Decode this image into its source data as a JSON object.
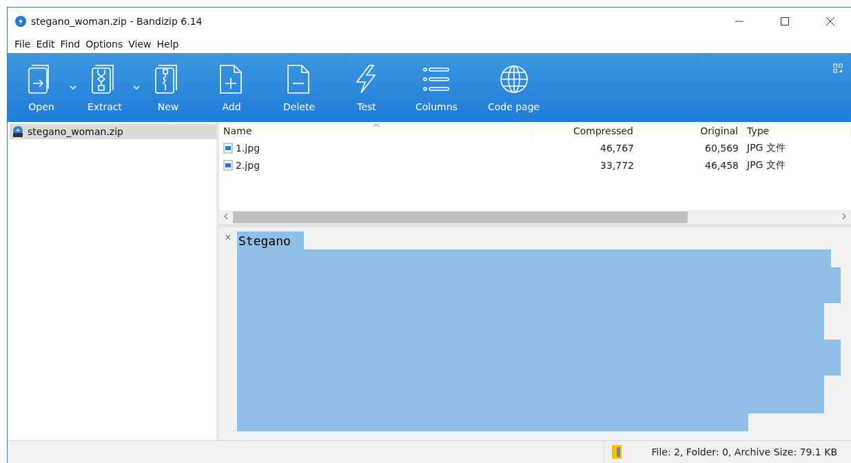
{
  "window": {
    "title": "stegano_woman.zip - Bandizip 6.14"
  },
  "menu": [
    "File",
    "Edit",
    "Find",
    "Options",
    "View",
    "Help"
  ],
  "toolbar": [
    {
      "label": "Open",
      "kind": "open",
      "has_menu": true
    },
    {
      "label": "Extract",
      "kind": "extract",
      "has_menu": true
    },
    {
      "label": "New",
      "kind": "new",
      "has_menu": false
    },
    {
      "label": "Add",
      "kind": "add",
      "has_menu": false
    },
    {
      "label": "Delete",
      "kind": "delete",
      "has_menu": false
    },
    {
      "label": "Test",
      "kind": "test",
      "has_menu": false
    },
    {
      "label": "Columns",
      "kind": "columns",
      "has_menu": false
    },
    {
      "label": "Code page",
      "kind": "globe",
      "has_menu": false
    }
  ],
  "sidebar": {
    "items": [
      {
        "label": "stegano_woman.zip",
        "selected": true
      }
    ]
  },
  "table": {
    "columns": [
      "Name",
      "Compressed",
      "Original",
      "Type"
    ],
    "rows": [
      {
        "name": "1.jpg",
        "compressed": "46,767",
        "original": "60,569",
        "type": "JPG 文件"
      },
      {
        "name": "2.jpg",
        "compressed": "33,772",
        "original": "46,458",
        "type": "JPG 文件"
      }
    ]
  },
  "comment": {
    "close": "×",
    "text": "Stegano",
    "selected": true
  },
  "status_bar": {
    "text": "File: 2, Folder: 0, Archive Size: 79.1 KB"
  }
}
